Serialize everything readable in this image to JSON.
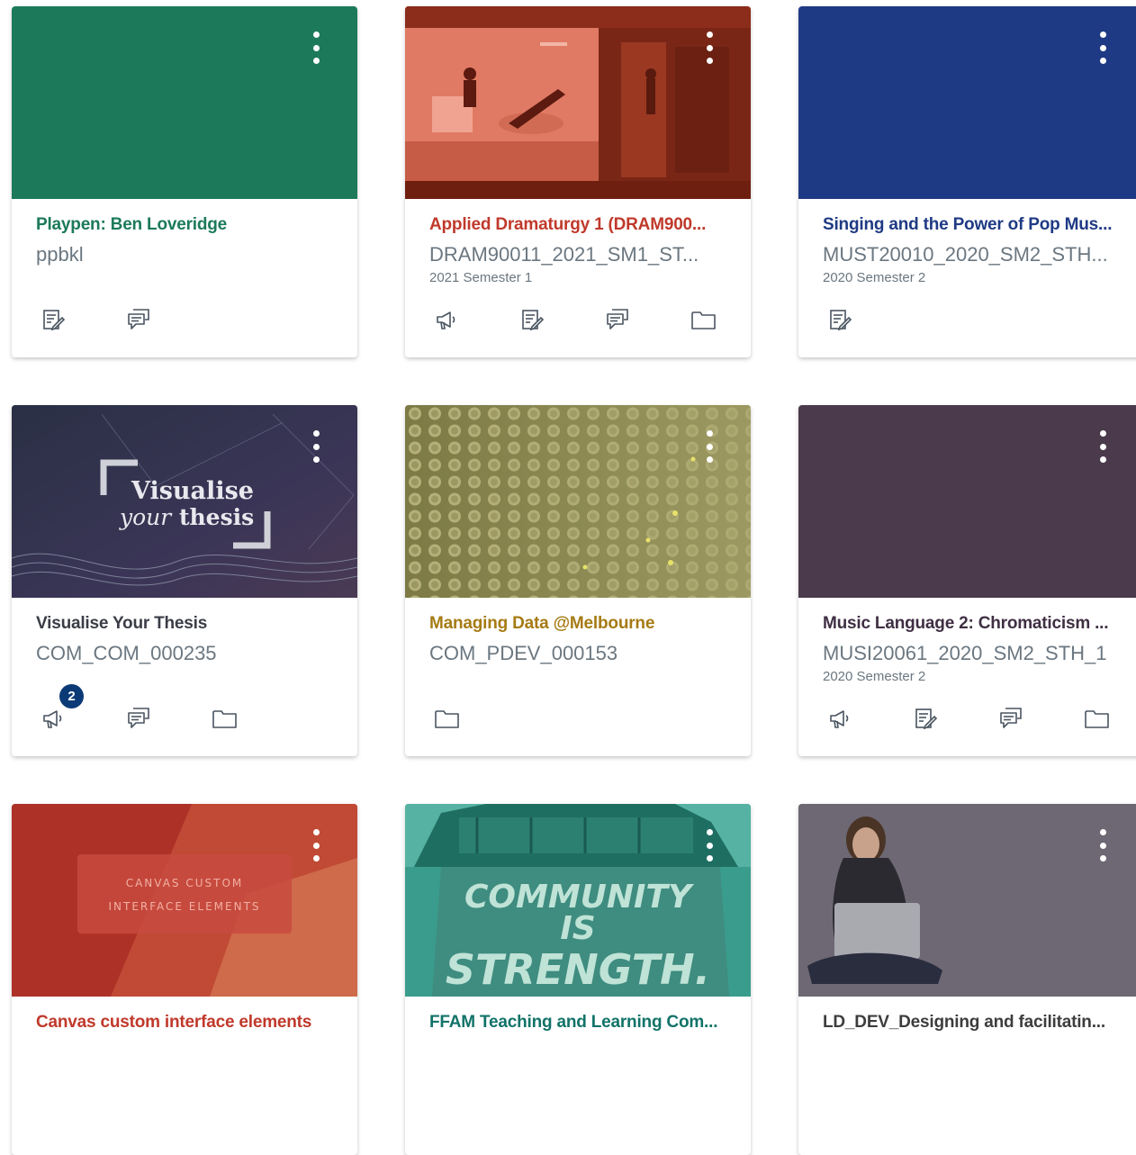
{
  "courses": [
    {
      "title": "Playpen: Ben Loveridge",
      "code": "ppbkl",
      "term": "",
      "color": "#1c7a5a",
      "icons": [
        "assignments-icon",
        "discussions-icon"
      ]
    },
    {
      "title": "Applied Dramaturgy 1 (DRAM900...",
      "code": "DRAM90011_2021_SM1_ST...",
      "term": "2021 Semester 1",
      "color": "#c0392b",
      "icons": [
        "announcements-icon",
        "assignments-icon",
        "discussions-icon",
        "files-icon"
      ]
    },
    {
      "title": "Singing and the Power of Pop Mus...",
      "code": "MUST20010_2020_SM2_STH...",
      "term": "2020 Semester 2",
      "color": "#1f3a84",
      "icons": [
        "assignments-icon"
      ]
    },
    {
      "title": "Visualise Your Thesis",
      "code": "COM_COM_000235",
      "term": "",
      "color": "#3a3d46",
      "icons": [
        "announcements-icon",
        "discussions-icon",
        "files-icon"
      ],
      "badge": "2"
    },
    {
      "title": "Managing Data @Melbourne",
      "code": "COM_PDEV_000153",
      "term": "",
      "color": "#a67b14",
      "icons": [
        "files-icon"
      ]
    },
    {
      "title": "Music Language 2: Chromaticism ...",
      "code": "MUSI20061_2020_SM2_STH_1",
      "term": "2020 Semester 2",
      "color": "#3f2f43",
      "icons": [
        "announcements-icon",
        "assignments-icon",
        "discussions-icon",
        "files-icon"
      ]
    },
    {
      "title": "Canvas custom interface elements",
      "code": "",
      "term": "",
      "color": "#c0392b",
      "icons": []
    },
    {
      "title": "FFAM Teaching and Learning Com...",
      "code": "",
      "term": "",
      "color": "#127369",
      "icons": []
    },
    {
      "title": "LD_DEV_Designing and facilitatin...",
      "code": "",
      "term": "",
      "color": "#3d3d3d",
      "icons": []
    }
  ],
  "hero_text": {
    "visualise_line1": "Visualise",
    "visualise_line2_a": "your",
    "visualise_line2_b": " thesis",
    "canvas_line1": "CANVAS CUSTOM",
    "canvas_line2": "INTERFACE ELEMENTS",
    "community_line1": "COMMUNITY",
    "community_line2": "IS",
    "community_line3": "STRENGTH."
  }
}
